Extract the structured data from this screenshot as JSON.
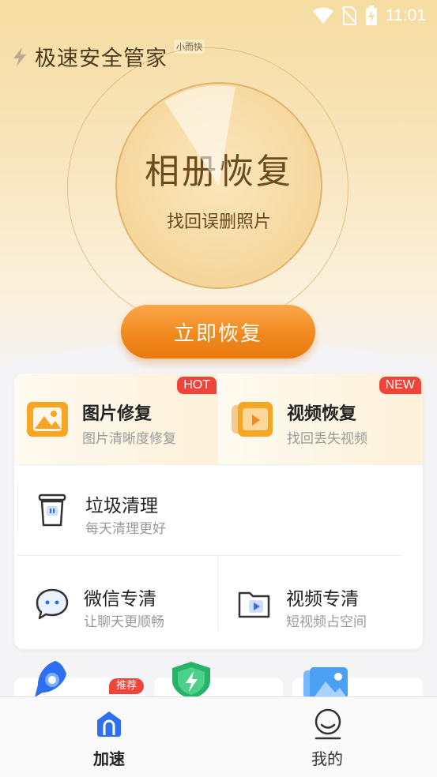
{
  "status_bar": {
    "time": "11:01"
  },
  "header": {
    "title": "极速安全管家",
    "subtitle": "小而快"
  },
  "hero": {
    "title": "相册恢复",
    "subtitle": "找回误删照片",
    "cta_label": "立即恢复"
  },
  "features": [
    {
      "title": "图片修复",
      "desc": "图片清晰度修复",
      "tag": "HOT"
    },
    {
      "title": "视频恢复",
      "desc": "找回丢失视频",
      "tag": "NEW"
    }
  ],
  "tools": [
    {
      "title": "垃圾清理",
      "desc": "每天清理更好"
    },
    {
      "title": "微信专清",
      "desc": "让聊天更顺畅"
    },
    {
      "title": "视频专清",
      "desc": "短视频占空间"
    }
  ],
  "promo": {
    "badge": "推荐"
  },
  "tabbar": {
    "tabs": [
      {
        "label": "加速",
        "active": true
      },
      {
        "label": "我的",
        "active": false
      }
    ]
  },
  "colors": {
    "accent": "#f08a1e",
    "tag_red": "#f0443a",
    "tab_active": "#2d6ff0"
  }
}
